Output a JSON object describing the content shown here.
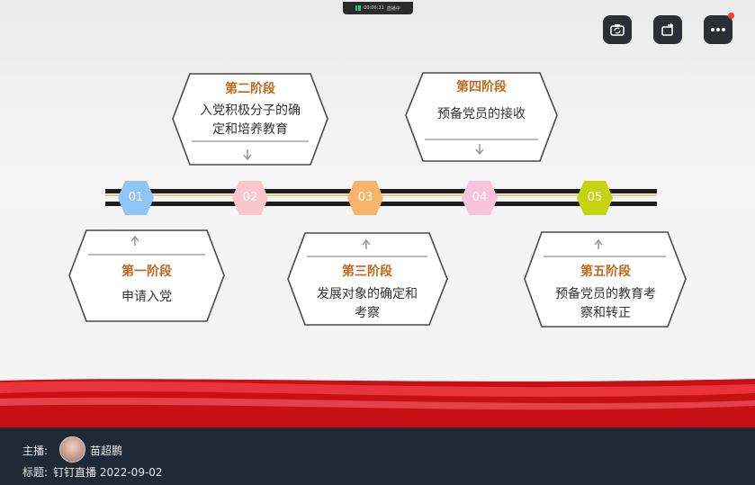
{
  "live_status": {
    "time": "00:06:31",
    "label": "直播中"
  },
  "timeline": {
    "nodes": [
      {
        "num": "01",
        "color": "#8ec5f5"
      },
      {
        "num": "02",
        "color": "#f9c6ce"
      },
      {
        "num": "03",
        "color": "#f8b46b"
      },
      {
        "num": "04",
        "color": "#f7c4dc"
      },
      {
        "num": "05",
        "color": "#c5d410"
      }
    ],
    "stages": [
      {
        "title": "第一阶段",
        "line1": "申请入党",
        "line2": ""
      },
      {
        "title": "第二阶段",
        "line1": "入党积极分子的确",
        "line2": "定和培养教育"
      },
      {
        "title": "第三阶段",
        "line1": "发展对象的确定和",
        "line2": "考察"
      },
      {
        "title": "第四阶段",
        "line1": "预备党员的接收",
        "line2": ""
      },
      {
        "title": "第五阶段",
        "line1": "预备党员的教育考",
        "line2": "察和转正"
      }
    ]
  },
  "footer": {
    "host_label": "主播:",
    "host_name": "苗超鹏",
    "title_label": "标题:",
    "title_value": "钉钉直播 2022-09-02"
  },
  "colors": {
    "stage_title": "#c0691d",
    "footer_bg": "#1f2a36",
    "accent_red": "#d8141c"
  },
  "icons": [
    "camera-switch-icon",
    "rotate-screen-icon",
    "more-icon",
    "signal-icon",
    "arrow-up-icon",
    "arrow-down-icon"
  ]
}
